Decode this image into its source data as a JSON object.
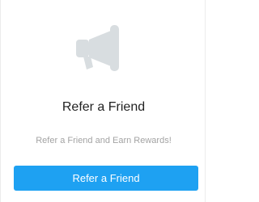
{
  "referral": {
    "icon": "megaphone-icon",
    "title": "Refer a Friend",
    "subtitle": "Refer a Friend and Earn Rewards!",
    "button_label": "Refer a Friend"
  },
  "colors": {
    "button_background": "#1ea1f2",
    "button_text": "#ffffff",
    "icon": "#d8dde0",
    "title": "#222222",
    "subtitle": "#a3a3a3"
  }
}
